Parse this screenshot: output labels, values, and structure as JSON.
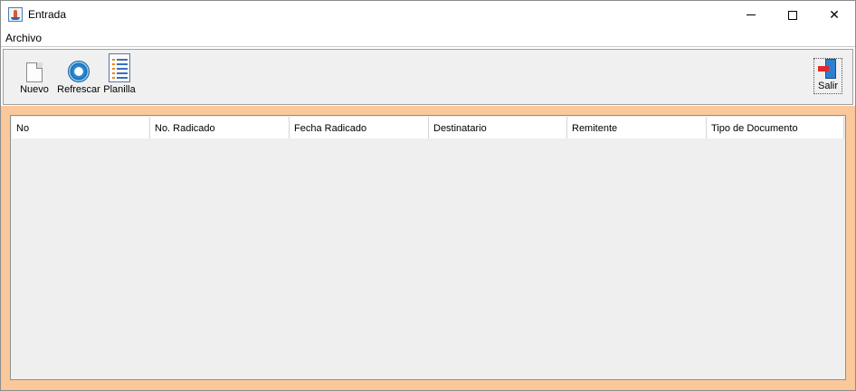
{
  "window": {
    "title": "Entrada",
    "controls": {
      "minimize_icon": "minimize-icon",
      "maximize_icon": "maximize-icon",
      "close_icon": "close-icon"
    }
  },
  "menubar": {
    "items": [
      {
        "label": "Archivo"
      }
    ]
  },
  "toolbar": {
    "nuevo": {
      "label": "Nuevo",
      "icon": "new-document-icon"
    },
    "refrescar": {
      "label": "Refrescar",
      "icon": "refresh-icon"
    },
    "planilla": {
      "label": "Planilla",
      "icon": "list-document-icon"
    },
    "salir": {
      "label": "Salir",
      "icon": "exit-door-icon"
    }
  },
  "table": {
    "columns": [
      "No",
      "No. Radicado",
      "Fecha Radicado",
      "Destinatario",
      "Remitente",
      "Tipo de Documento"
    ],
    "rows": []
  },
  "colors": {
    "content_background": "#fbc89b",
    "table_background": "#efefef",
    "toolbar_background": "#f0f0f0"
  }
}
